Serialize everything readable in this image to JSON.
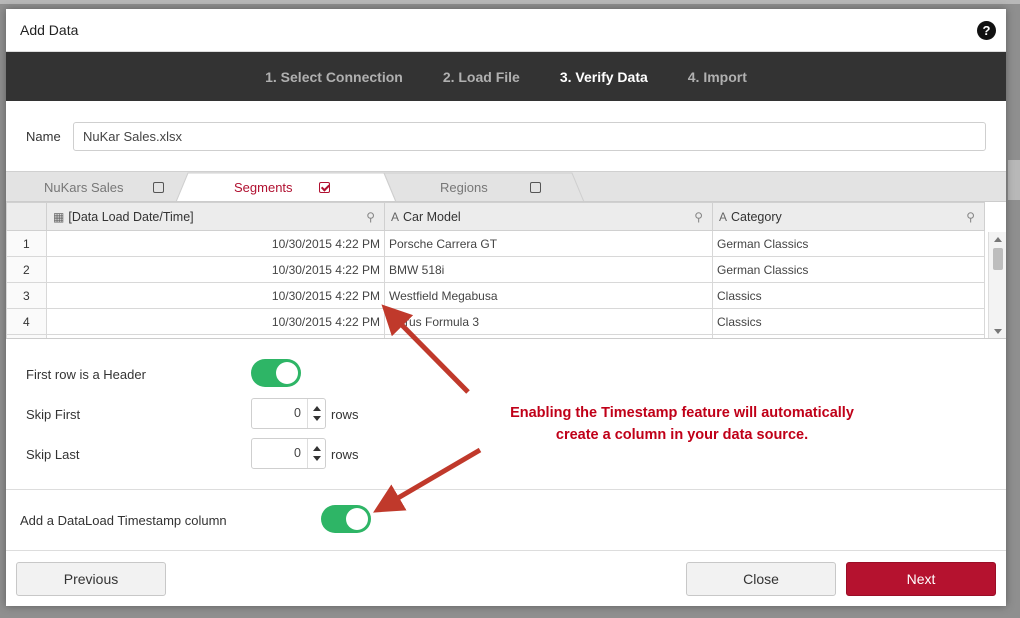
{
  "dialog": {
    "title": "Add Data",
    "help_icon": "question-circle-icon"
  },
  "wizard_steps": [
    {
      "label": "1. Select Connection",
      "active": false
    },
    {
      "label": "2. Load File",
      "active": false
    },
    {
      "label": "3. Verify Data",
      "active": true
    },
    {
      "label": "4. Import",
      "active": false
    }
  ],
  "name_field": {
    "label": "Name",
    "value": "NuKar Sales.xlsx"
  },
  "sheet_tabs": [
    {
      "label": "NuKars Sales",
      "checked": false
    },
    {
      "label": "Segments",
      "checked": true,
      "active": true
    },
    {
      "label": "Regions",
      "checked": false
    }
  ],
  "grid": {
    "columns": [
      {
        "label": "[Data Load Date/Time]",
        "icon": "calendar-icon"
      },
      {
        "label": "Car Model",
        "icon": "text-type-icon"
      },
      {
        "label": "Category",
        "icon": "text-type-icon"
      }
    ],
    "rows": [
      {
        "num": "1",
        "date": "10/30/2015 4:22 PM",
        "model": "Porsche Carrera GT",
        "category": "German Classics"
      },
      {
        "num": "2",
        "date": "10/30/2015 4:22 PM",
        "model": "BMW 518i",
        "category": "German Classics"
      },
      {
        "num": "3",
        "date": "10/30/2015 4:22 PM",
        "model": "Westfield Megabusa",
        "category": "Classics"
      },
      {
        "num": "4",
        "date": "10/30/2015 4:22 PM",
        "model": "rus Formula 3",
        "category": "Classics"
      }
    ]
  },
  "options": {
    "header_label": "First row is a Header",
    "header_on": true,
    "skip_first_label": "Skip First",
    "skip_first_value": "0",
    "skip_last_label": "Skip Last",
    "skip_last_value": "0",
    "rows_unit": "rows",
    "timestamp_label": "Add a DataLoad Timestamp column",
    "timestamp_on": true
  },
  "annotation": {
    "line1": "Enabling the Timestamp feature will automatically",
    "line2": "create a column in your data source.",
    "color": "#c00018"
  },
  "footer": {
    "previous": "Previous",
    "close": "Close",
    "next": "Next"
  },
  "colors": {
    "accent": "#b5122f",
    "toggle_on": "#2eb566",
    "steps_bar": "#333333"
  }
}
